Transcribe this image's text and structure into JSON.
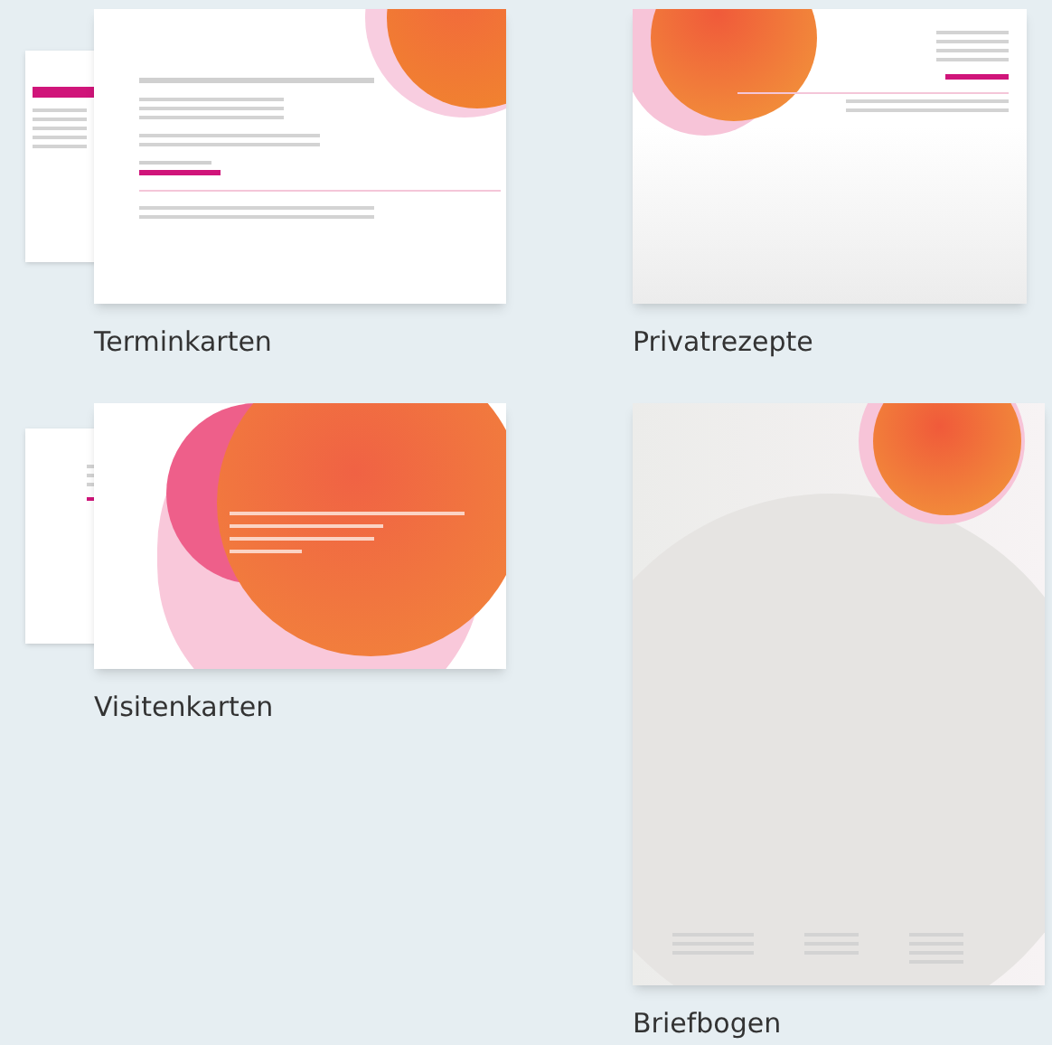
{
  "items": [
    {
      "label": "Terminkarten",
      "kind": "appointment-cards"
    },
    {
      "label": "Privatrezepte",
      "kind": "prescription"
    },
    {
      "label": "Visitenkarten",
      "kind": "business-cards"
    },
    {
      "label": "Briefbogen",
      "kind": "letterhead"
    }
  ]
}
